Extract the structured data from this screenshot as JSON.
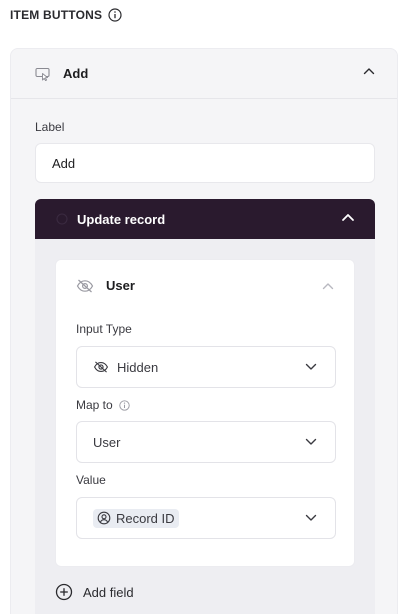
{
  "section": {
    "title": "ITEM BUTTONS"
  },
  "item": {
    "title": "Add",
    "label_field": {
      "label": "Label",
      "value": "Add"
    }
  },
  "action": {
    "title": "Update record",
    "field": {
      "title": "User",
      "input_type": {
        "label": "Input Type",
        "value": "Hidden"
      },
      "map_to": {
        "label": "Map to",
        "value": "User"
      },
      "value": {
        "label": "Value",
        "value": "Record ID"
      }
    },
    "add_field_label": "Add field"
  },
  "colors": {
    "action_header": "#2a1a2e",
    "panel_bg": "#f5f5f7"
  },
  "icons": [
    "info-icon",
    "cursor-click-icon",
    "chevron-up-icon",
    "eye-off-icon",
    "chevron-down-icon",
    "user-circle-icon",
    "plus-circle-icon"
  ]
}
